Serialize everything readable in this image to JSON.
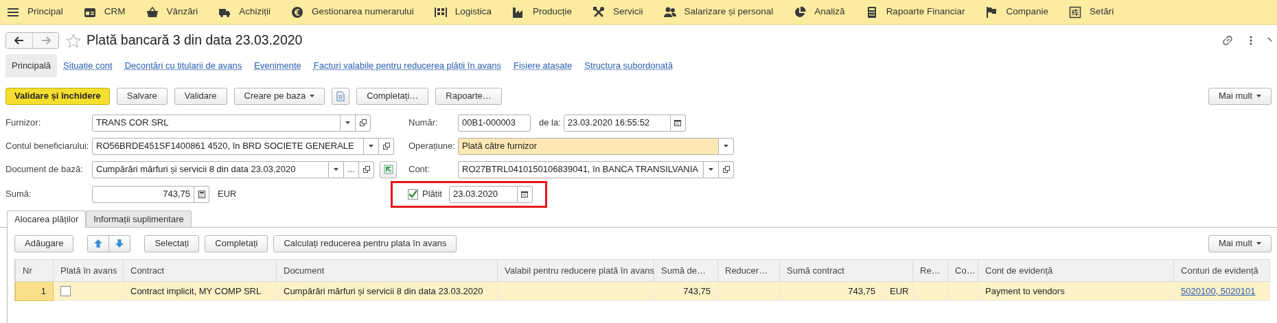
{
  "top_menu": [
    {
      "label": "Principal"
    },
    {
      "label": "CRM"
    },
    {
      "label": "Vânzări"
    },
    {
      "label": "Achiziții"
    },
    {
      "label": "Gestionarea numerarului"
    },
    {
      "label": "Logistica"
    },
    {
      "label": "Producție"
    },
    {
      "label": "Servicii"
    },
    {
      "label": "Salarizare și personal"
    },
    {
      "label": "Analiză"
    },
    {
      "label": "Rapoarte Financiar"
    },
    {
      "label": "Companie"
    },
    {
      "label": "Setări"
    }
  ],
  "document": {
    "title": "Plată bancară 3 din data 23.03.2020"
  },
  "sections": [
    {
      "label": "Principală",
      "selected": true
    },
    {
      "label": "Situație cont",
      "selected": false
    },
    {
      "label": "Decontări cu titularii de avans",
      "selected": false
    },
    {
      "label": "Evenimente",
      "selected": false
    },
    {
      "label": "Facturi valabile pentru reducerea plății în avans",
      "selected": false
    },
    {
      "label": "Fișiere atașate",
      "selected": false
    },
    {
      "label": "Structura subordonată",
      "selected": false
    }
  ],
  "toolbar": [
    {
      "kind": "primary",
      "label": "Validare și închidere"
    },
    {
      "kind": "plain",
      "label": "Salvare"
    },
    {
      "kind": "plain",
      "label": "Validare"
    },
    {
      "kind": "dropdown",
      "label": "Creare pe baza"
    },
    {
      "kind": "icon"
    },
    {
      "kind": "plain",
      "label": "Completați…"
    },
    {
      "kind": "plain",
      "label": "Rapoarte…"
    }
  ],
  "more_button": {
    "label": "Mai mult"
  },
  "form_left": [
    {
      "label": "Furnizor:",
      "value": "TRANS COR SRL",
      "buttons": [
        {
          "kind": "dropdown"
        },
        {
          "kind": "open"
        }
      ]
    },
    {
      "label": "Contul beneficiarului:",
      "value": "RO56BRDE451SF1400861 4520, în BRD SOCIETE GENERALE",
      "buttons": [
        {
          "kind": "dropdown"
        },
        {
          "kind": "open"
        }
      ]
    },
    {
      "label": "Document de bază:",
      "value": "Cumpărări mărfuri și servicii 8 din data 23.03.2020",
      "buttons": [
        {
          "kind": "dropdown"
        },
        {
          "kind": "select",
          "label": "..."
        },
        {
          "kind": "open"
        }
      ],
      "extra_button": true
    },
    {
      "label": "Sumă:",
      "value": "743,75",
      "buttons": [
        {
          "kind": "calculator"
        }
      ],
      "suffix": "EUR"
    }
  ],
  "number": {
    "label": "Număr:",
    "value": "00B1-000003",
    "date_label": "de la:",
    "date": "23.03.2020 16:55:52"
  },
  "operation": {
    "label": "Operațiune:",
    "value": "Plată către furnizor",
    "highlighted": true
  },
  "account": {
    "label": "Cont:",
    "value": "RO27BTRL0410150106839041, în BANCA TRANSILVANIA"
  },
  "paid": {
    "label": "Plătit",
    "checked": true,
    "date": "23.03.2020"
  },
  "tabs": [
    {
      "label": "Alocarea plăților",
      "selected": true
    },
    {
      "label": "Informații suplimentare",
      "selected": false
    }
  ],
  "table_toolbar": [
    {
      "kind": "plain",
      "label": "Adăugare"
    },
    {
      "kind": "up"
    },
    {
      "kind": "down"
    },
    {
      "kind": "plain",
      "label": "Selectați"
    },
    {
      "kind": "plain",
      "label": "Completați"
    },
    {
      "kind": "plain",
      "label": "Calculați reducerea pentru plata în avans"
    }
  ],
  "table_more_button": {
    "label": "Mai mult"
  },
  "table": {
    "columns": [
      {
        "label": "Nr"
      },
      {
        "label": "Plată în avans"
      },
      {
        "label": "Contract"
      },
      {
        "label": "Document"
      },
      {
        "label": "Valabil pentru reducere plată în avans"
      },
      {
        "label": "Sumă de…"
      },
      {
        "label": "Reducer…"
      },
      {
        "label": "Sumă contract"
      },
      {
        "label": "Re…"
      },
      {
        "label": "Co…"
      },
      {
        "label": "Cont de evidență"
      },
      {
        "label": "Conturi de evidență"
      }
    ],
    "rows": [
      {
        "selected": true,
        "nr": "1",
        "advance": false,
        "contract": "Contract implicit, MY COMP SRL",
        "document": "Cumpărări mărfuri și servicii 8 din data 23.03.2020",
        "amount": "743,75",
        "contract_amount": "743,75",
        "currency": "EUR",
        "account": "Payment to vendors",
        "accounts": "5020100, 5020101"
      }
    ]
  }
}
